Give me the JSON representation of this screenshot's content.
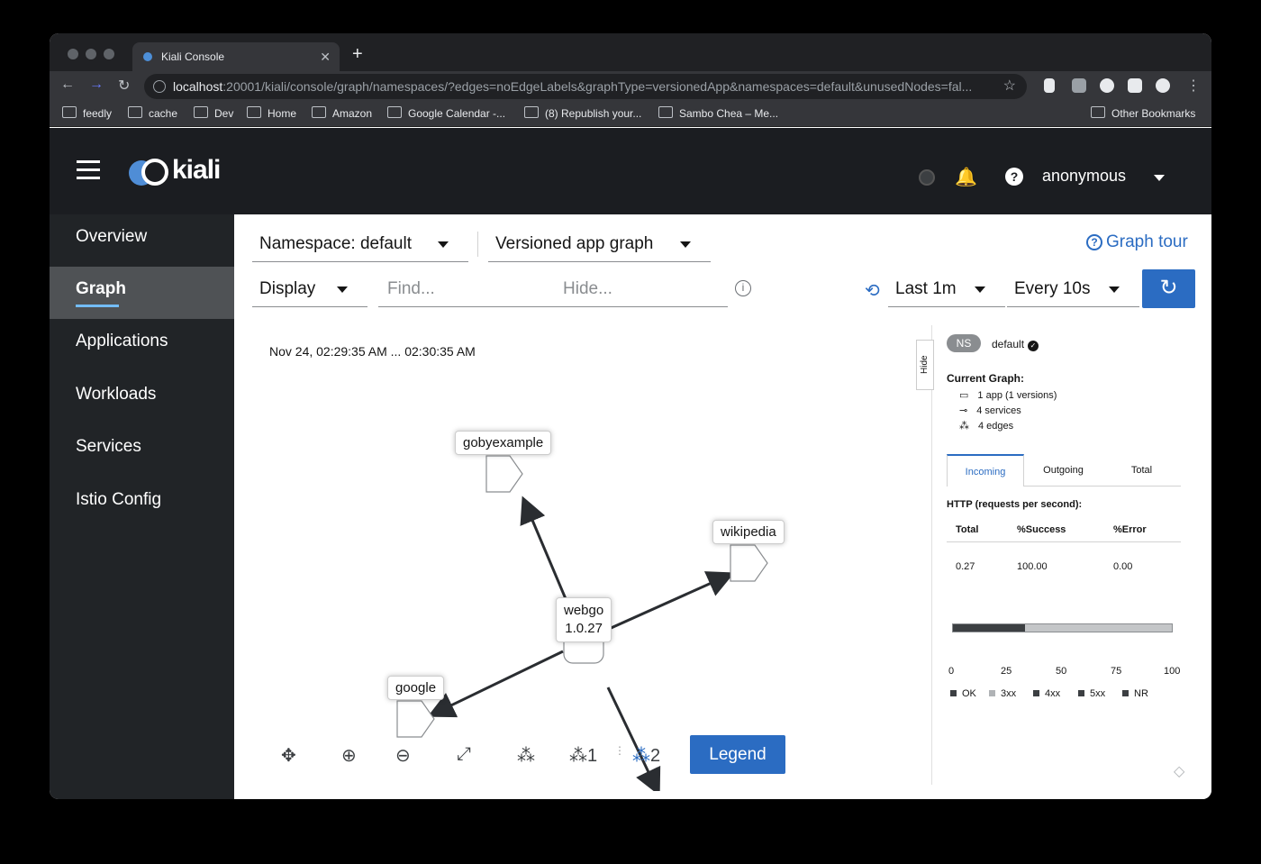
{
  "browser": {
    "tab_title": "Kiali Console",
    "url_host": "localhost",
    "url_rest": ":20001/kiali/console/graph/namespaces/?edges=noEdgeLabels&graphType=versionedApp&namespaces=default&unusedNodes=fal...",
    "bookmarks": [
      "feedly",
      "cache",
      "Dev",
      "Home",
      "Amazon",
      "Google Calendar -...",
      "(8) Republish your...",
      "Sambo Chea – Me..."
    ],
    "other_bookmarks": "Other Bookmarks"
  },
  "masthead": {
    "logo_text": "kiali",
    "user": "anonymous"
  },
  "sidebar": {
    "items": [
      {
        "label": "Overview"
      },
      {
        "label": "Graph",
        "active": true
      },
      {
        "label": "Applications"
      },
      {
        "label": "Workloads"
      },
      {
        "label": "Services"
      },
      {
        "label": "Istio Config"
      }
    ]
  },
  "toolbar": {
    "namespace": "Namespace: default",
    "graph_type": "Versioned app graph",
    "graph_tour": "Graph tour",
    "display": "Display",
    "find_placeholder": "Find...",
    "hide_placeholder": "Hide...",
    "duration": "Last 1m",
    "refresh_interval": "Every 10s"
  },
  "graph": {
    "timestamp": "Nov 24, 02:29:35 AM ... 02:30:35 AM",
    "nodes": {
      "gobyexample": "gobyexample",
      "wikipedia": "wikipedia",
      "google": "google",
      "webgo_name": "webgo",
      "webgo_version": "1.0.27"
    },
    "layout_1_label": "1",
    "layout_2_label": "2",
    "legend_button": "Legend"
  },
  "panel": {
    "hide_tab": "Hide",
    "ns_badge": "NS",
    "ns_name": "default",
    "current_graph_title": "Current Graph:",
    "apps": "1 app (1 versions)",
    "services": "4 services",
    "edges": "4 edges",
    "tabs": [
      "Incoming",
      "Outgoing",
      "Total"
    ],
    "http_title": "HTTP (requests per second):",
    "columns": [
      "Total",
      "%Success",
      "%Error"
    ],
    "row": [
      "0.27",
      "100.00",
      "0.00"
    ],
    "ok_percent": 33,
    "axis_ticks": [
      "0",
      "25",
      "50",
      "75",
      "100"
    ],
    "legend": [
      "OK",
      "3xx",
      "4xx",
      "5xx",
      "NR"
    ],
    "colors": {
      "ok": "#3c3f42",
      "3xx": "#b0b3b6",
      "accent": "#2b6cc2"
    }
  }
}
